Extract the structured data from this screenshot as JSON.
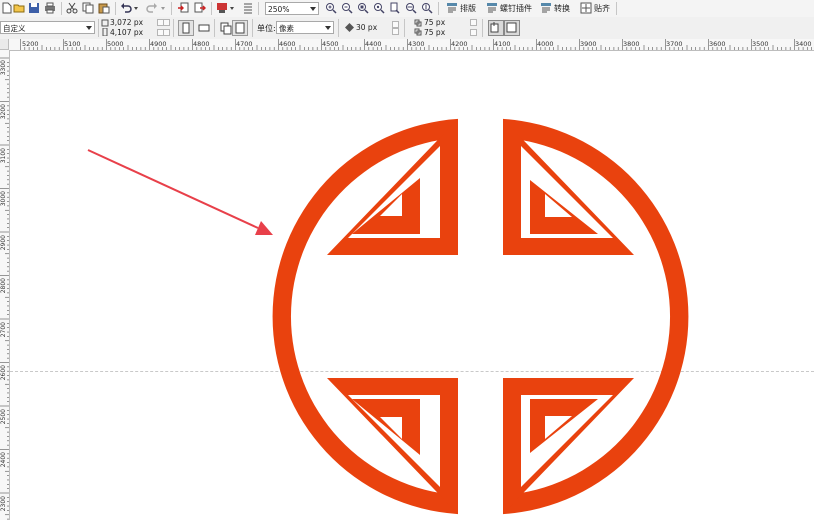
{
  "toolbar": {
    "zoom_value": "250%",
    "typeset_label": "排版",
    "plugins_label": "螺钉插件",
    "transform_label": "转换",
    "paste_label": "贴齐"
  },
  "property_bar": {
    "page_preset": "自定义",
    "width_value": "3,072 px",
    "height_value": "4,107 px",
    "units_label": "单位:",
    "units_value": "像素",
    "nudge_value": "30 px",
    "dup_x_value": "75 px",
    "dup_y_value": "75 px"
  },
  "ruler": {
    "top_labels": [
      "5200",
      "5100",
      "5000",
      "4900",
      "4800",
      "4700",
      "4600",
      "4500",
      "4400",
      "4300",
      "4200",
      "4100",
      "4000",
      "3900",
      "3800",
      "3700",
      "3600",
      "3500",
      "3400"
    ],
    "left_labels": [
      "3300",
      "3200",
      "3100",
      "3000",
      "2900",
      "2800",
      "2700",
      "2600",
      "2500",
      "2400",
      "2300"
    ]
  },
  "colors": {
    "symbol": "#E9420E",
    "arrow": "#E8404A",
    "guide": "#C9C9C9",
    "toolbar_bg": "#F0F0F0"
  },
  "icons": [
    "new-file-icon",
    "open-icon",
    "save-icon",
    "print-icon",
    "cut-icon",
    "copy-icon",
    "paste-icon",
    "undo-icon",
    "redo-icon",
    "import-icon",
    "export-icon",
    "publish-icon",
    "app-launcher-icon",
    "zoom-in-icon",
    "zoom-out-icon",
    "zoom-selected-icon",
    "zoom-all-icon",
    "zoom-page-icon",
    "zoom-width-icon",
    "zoom-height-icon",
    "typeset-icon",
    "plugins-icon",
    "transform-icon",
    "snap-icon",
    "portrait-icon",
    "landscape-icon",
    "all-pages-icon",
    "current-page-icon",
    "nudge-icon",
    "duplicate-x-icon",
    "duplicate-y-icon",
    "treat-as-filled-icon",
    "wrap-icon"
  ]
}
